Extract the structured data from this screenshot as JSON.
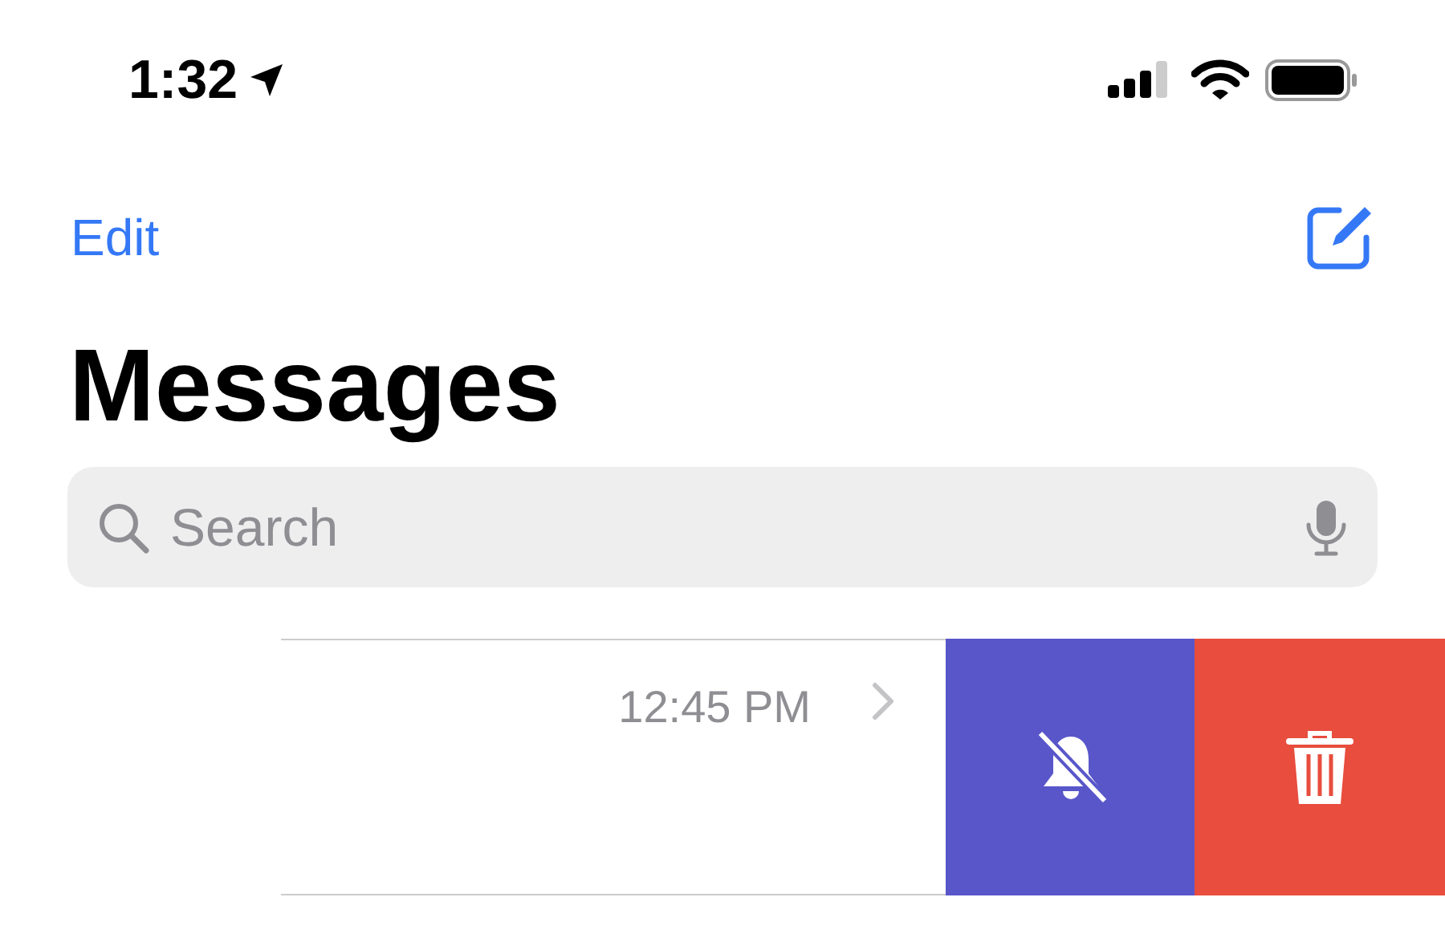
{
  "status_bar": {
    "time": "1:32"
  },
  "nav": {
    "edit": "Edit"
  },
  "title": "Messages",
  "search": {
    "placeholder": "Search"
  },
  "conversation": {
    "time": "12:45 PM",
    "actions": [
      {
        "kind": "mute"
      },
      {
        "kind": "delete"
      }
    ]
  }
}
